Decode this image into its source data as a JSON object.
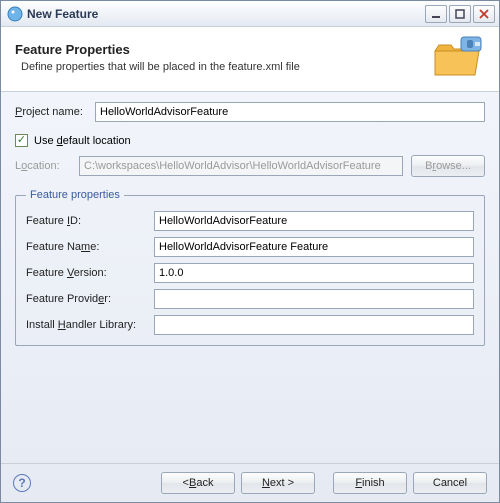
{
  "window": {
    "title": "New Feature"
  },
  "banner": {
    "title": "Feature Properties",
    "description": "Define properties that will be placed in the feature.xml file"
  },
  "projectName": {
    "label": "Project name:",
    "value": "HelloWorldAdvisorFeature"
  },
  "useDefault": {
    "label": "Use default location",
    "checked": true
  },
  "location": {
    "label": "Location:",
    "value": "C:\\workspaces\\HelloWorldAdvisor\\HelloWorldAdvisorFeature",
    "browse": "Browse..."
  },
  "group": {
    "legend": "Feature properties",
    "id": {
      "label": "Feature ID:",
      "value": "HelloWorldAdvisorFeature"
    },
    "name": {
      "label": "Feature Name:",
      "value": "HelloWorldAdvisorFeature Feature"
    },
    "version": {
      "label": "Feature Version:",
      "value": "1.0.0"
    },
    "provider": {
      "label": "Feature Provider:",
      "value": ""
    },
    "handler": {
      "label": "Install Handler Library:",
      "value": ""
    }
  },
  "buttons": {
    "back": "< Back",
    "next": "Next >",
    "finish": "Finish",
    "cancel": "Cancel"
  }
}
